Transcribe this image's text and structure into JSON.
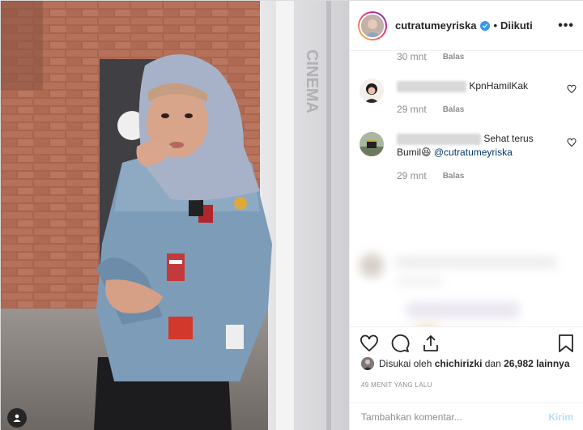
{
  "header": {
    "username": "cutratumeyriska",
    "separator": "•",
    "follow_status": "Diikuti",
    "more": "•••"
  },
  "comments": [
    {
      "time": "30 mnt",
      "reply": "Balas"
    },
    {
      "text": "KpnHamilKak",
      "time": "29 mnt",
      "reply": "Balas"
    },
    {
      "text": "Sehat terus",
      "text2": "Bumil",
      "emoji": "😆",
      "mention": "@cutratumeyriska",
      "time": "29 mnt",
      "reply": "Balas"
    }
  ],
  "likes": {
    "prefix": "Disukai oleh",
    "user": "chichirizki",
    "middle": "dan",
    "count": "26,982 lainnya"
  },
  "timeago": "49 MENIT YANG LALU",
  "add_comment": {
    "placeholder": "Tambahkan komentar...",
    "post": "Kirim"
  },
  "icons": [
    "heart-icon",
    "comment-icon",
    "share-icon",
    "bookmark-icon",
    "verified-icon",
    "user-tag-icon"
  ],
  "colors": {
    "verified": "#3897f0",
    "mention": "#00376b",
    "post_disabled": "#b2dffc"
  }
}
